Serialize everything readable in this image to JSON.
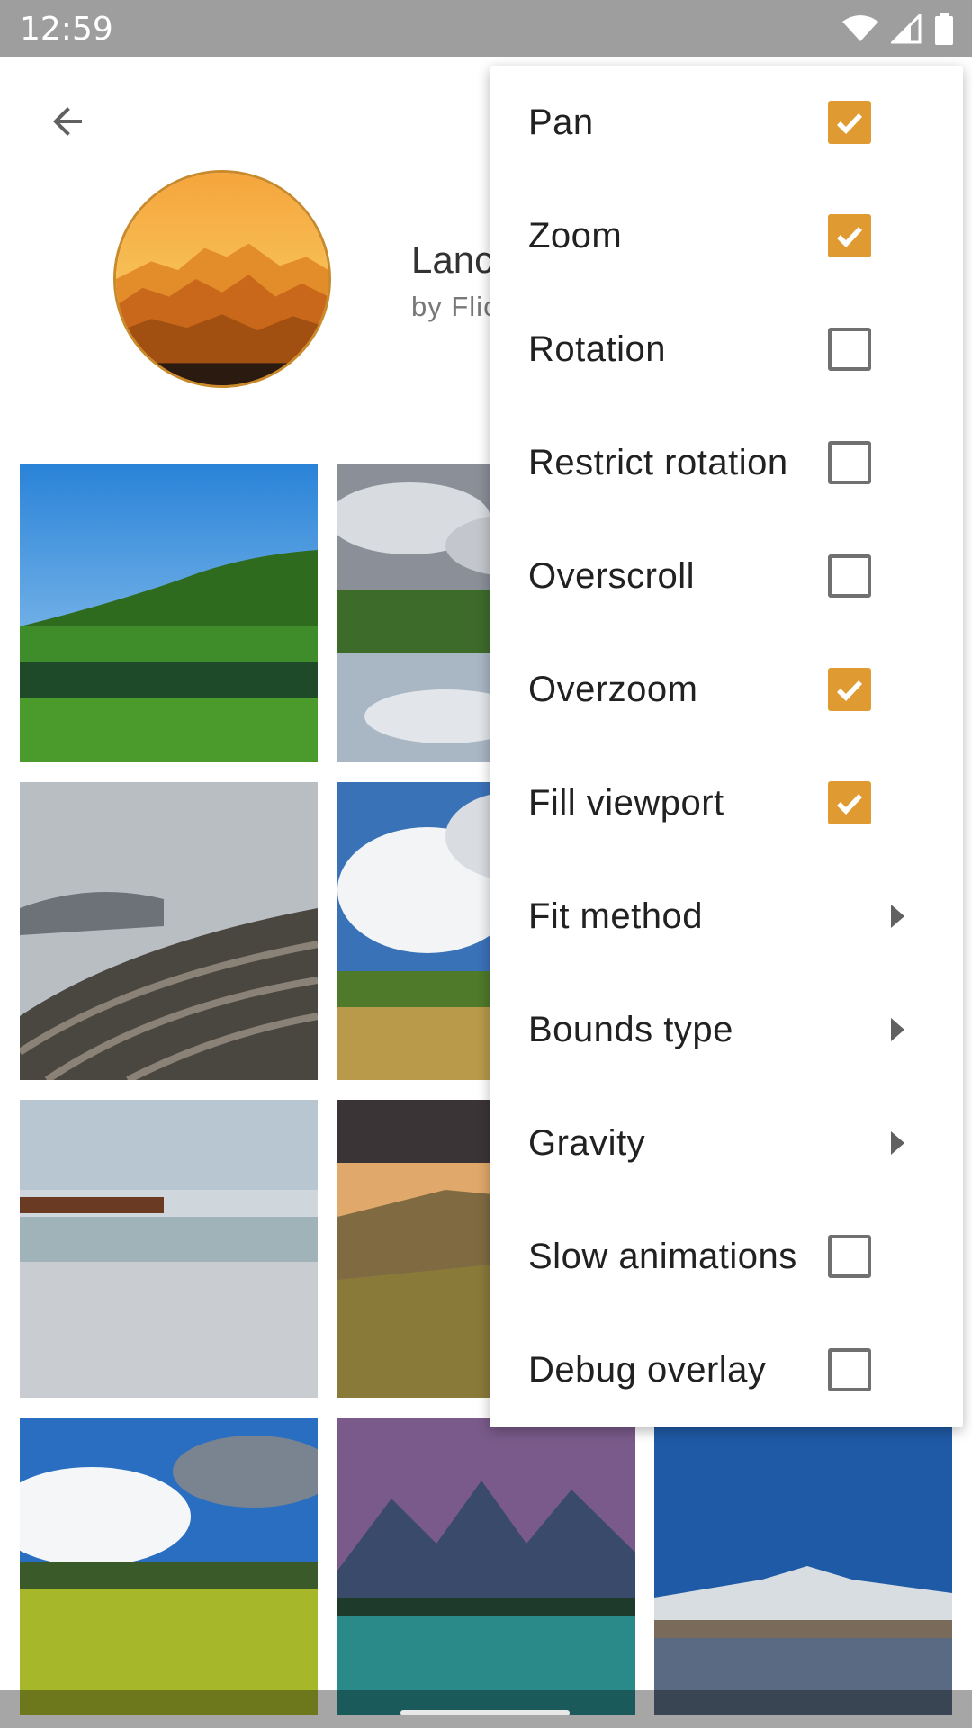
{
  "status_bar": {
    "time": "12:59",
    "icons": [
      "wifi-icon",
      "cell-signal-icon",
      "battery-icon"
    ]
  },
  "header": {
    "back_icon": "arrow-back-icon",
    "title": "Lanc",
    "subtitle": "by Flic"
  },
  "gallery": {
    "tiles": [
      "photo-green-hills-lake",
      "photo-cloudy-lake-reflection",
      "photo-rice-terraces",
      "photo-cloud-sky-field",
      "photo-beach-shore",
      "photo-valley-sunset",
      "photo-meadow-clouds",
      "photo-mountain-lake",
      "photo-snowy-mountain-lake"
    ]
  },
  "menu": {
    "items": [
      {
        "label": "Pan",
        "type": "checkbox",
        "checked": true
      },
      {
        "label": "Zoom",
        "type": "checkbox",
        "checked": true
      },
      {
        "label": "Rotation",
        "type": "checkbox",
        "checked": false
      },
      {
        "label": "Restrict rotation",
        "type": "checkbox",
        "checked": false
      },
      {
        "label": "Overscroll",
        "type": "checkbox",
        "checked": false
      },
      {
        "label": "Overzoom",
        "type": "checkbox",
        "checked": true
      },
      {
        "label": "Fill viewport",
        "type": "checkbox",
        "checked": true
      },
      {
        "label": "Fit method",
        "type": "submenu"
      },
      {
        "label": "Bounds type",
        "type": "submenu"
      },
      {
        "label": "Gravity",
        "type": "submenu"
      },
      {
        "label": "Slow animations",
        "type": "checkbox",
        "checked": false
      },
      {
        "label": "Debug overlay",
        "type": "checkbox",
        "checked": false
      }
    ],
    "accent_color": "#e09a32"
  }
}
